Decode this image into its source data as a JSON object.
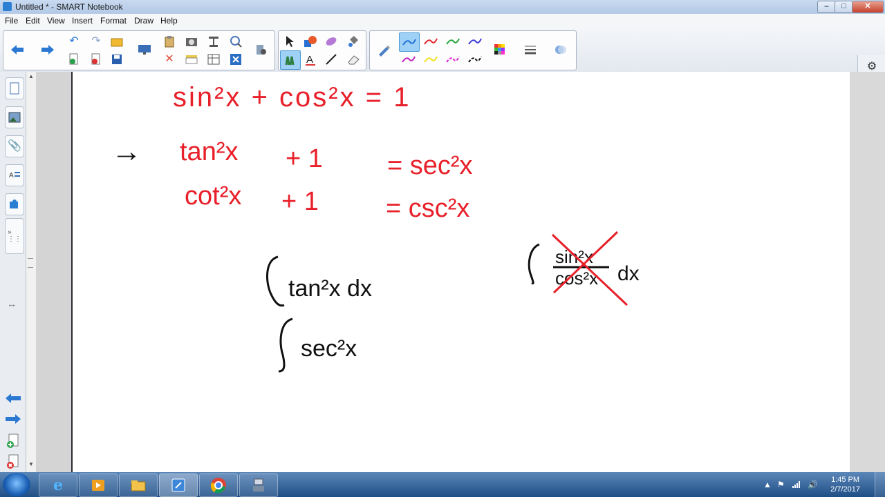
{
  "window": {
    "title": "Untitled * - SMART Notebook",
    "controls": {
      "minimize": "–",
      "maximize": "□",
      "close": "✕"
    }
  },
  "menu": [
    "File",
    "Edit",
    "View",
    "Insert",
    "Format",
    "Draw",
    "Help"
  ],
  "toolbar": {
    "nav": [
      "back-arrow-icon",
      "forward-arrow-icon"
    ],
    "pen_colors": [
      "#1d6fd8",
      "#e8202a",
      "#1fa53a",
      "#3a3ad6",
      "#c01fbf",
      "#f2e21a",
      "#e01fd4",
      "#111111"
    ],
    "selected_pen_color": "#1d6fd8"
  },
  "canvas": {
    "ink_red": "#e8202a",
    "ink_black": "#111111",
    "lines": {
      "l1": "sin²x + cos²x = 1",
      "l2a": "tan²x",
      "l2b": "+ 1",
      "l2c": "= sec²x",
      "l3a": "cot²x",
      "l3b": "+ 1",
      "l3c": "= csc²x",
      "arrow": "→",
      "int1": "tan²x dx",
      "int2": "sec²x",
      "int3_num": "sin²x",
      "int3_den": "cos²x",
      "int3_dx": "dx"
    }
  },
  "taskbar": {
    "time": "1:45 PM",
    "date": "2/7/2017",
    "apps": [
      "internet-explorer",
      "media-player",
      "file-explorer",
      "smart-notebook",
      "chrome",
      "smart-tools"
    ]
  }
}
